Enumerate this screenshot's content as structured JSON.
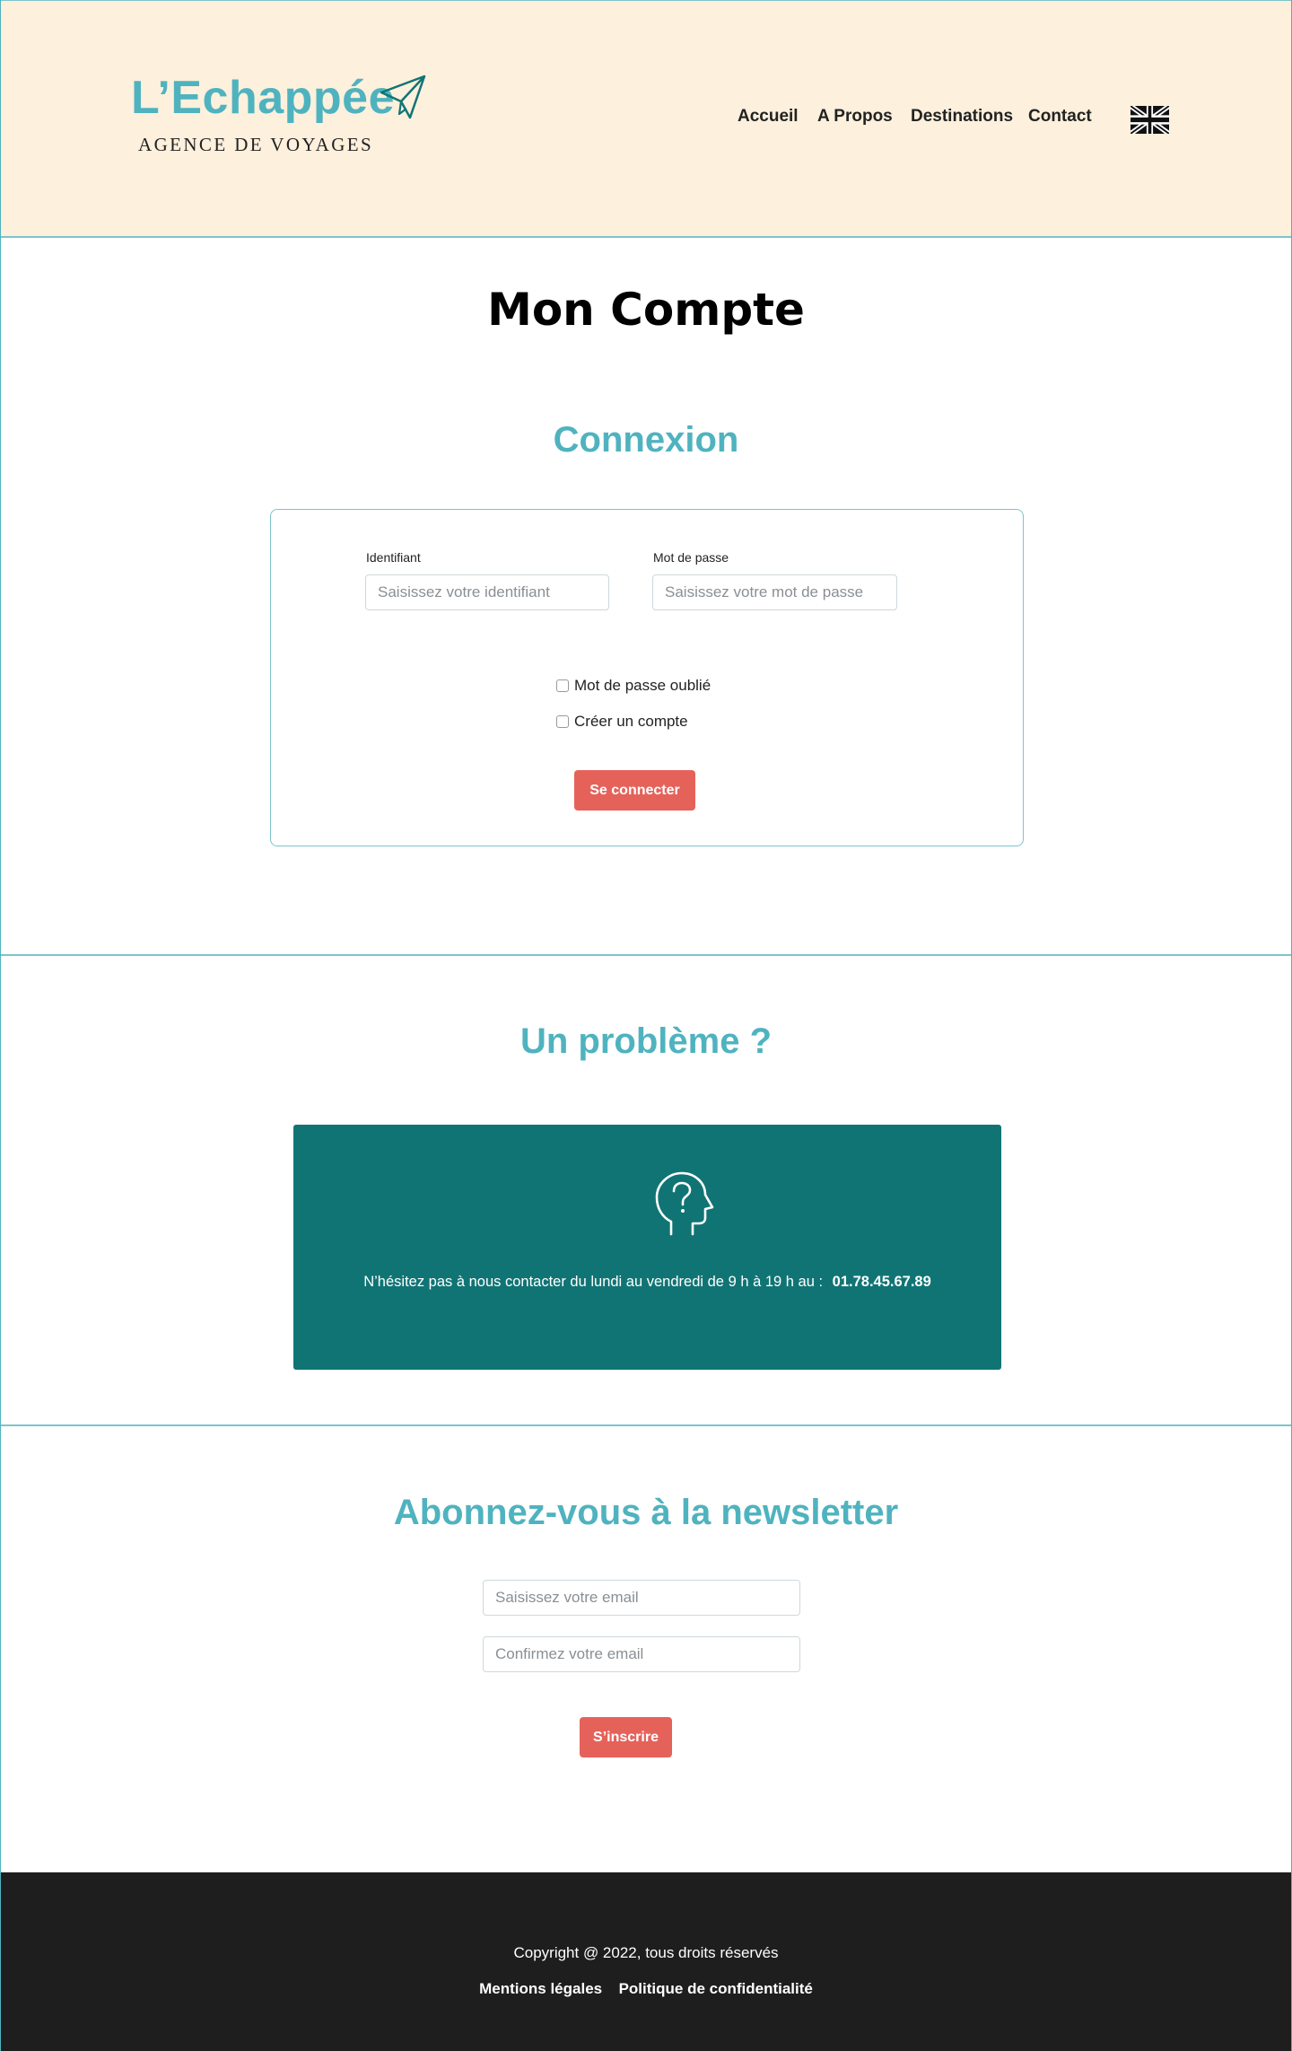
{
  "header": {
    "logo_title": "L’Echappée",
    "logo_subtitle": "AGENCE DE VOYAGES",
    "nav": [
      "Accueil",
      "A Propos",
      "Destinations",
      "Contact"
    ],
    "language_icon": "uk-flag-icon"
  },
  "page_title": "Mon Compte",
  "login": {
    "title": "Connexion",
    "identifier_label": "Identifiant",
    "identifier_placeholder": "Saisissez votre identifiant",
    "password_label": "Mot de passe",
    "password_placeholder": "Saisissez votre mot de passe",
    "forgot_password": "Mot de passe oublié",
    "create_account": "Créer un compte",
    "submit": "Se connecter"
  },
  "help": {
    "title": "Un problème ?",
    "icon": "head-question-icon",
    "text": "N’hésitez pas à nous contacter du lundi au vendredi de 9 h à 19 h au :",
    "phone": "01.78.45.67.89"
  },
  "newsletter": {
    "title": "Abonnez-vous à la newsletter",
    "email_placeholder": "Saisissez votre email",
    "confirm_placeholder": "Confirmez votre email",
    "submit": "S’inscrire"
  },
  "footer": {
    "copyright": "Copyright @ 2022, tous droits réservés",
    "links": [
      "Mentions légales",
      "Politique de confidentialité"
    ]
  },
  "colors": {
    "accent": "#4fb3bf",
    "header_bg": "#fdf0dc",
    "button": "#e5625a",
    "help_bg": "#117474",
    "footer_bg": "#1f1e1f"
  }
}
